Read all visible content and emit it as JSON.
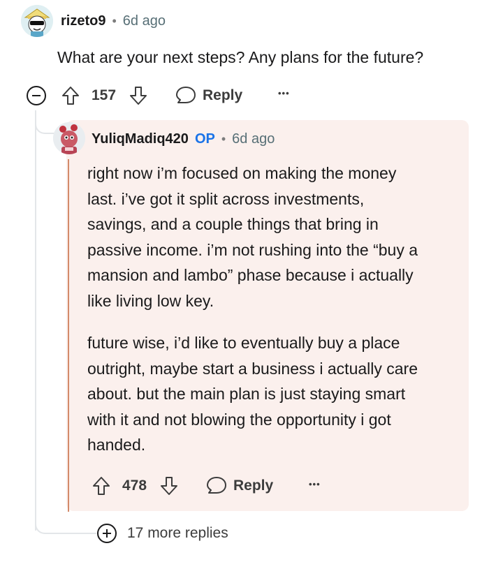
{
  "comment": {
    "username": "rizeto9",
    "separator": "•",
    "time": "6d ago",
    "body": "What are your next steps? Any plans for the future?",
    "votes": "157",
    "reply_label": "Reply",
    "more_label": "•••"
  },
  "reply": {
    "username": "YuliqMadiq420",
    "op_badge": "OP",
    "separator": "•",
    "time": "6d ago",
    "paragraph1": [
      "right now i’m focused on making the money",
      "last. i’ve got it split across investments,",
      "savings, and a couple things that bring in",
      "passive income. i’m not rushing into the “buy a",
      "mansion and lambo” phase because i actually",
      "like living low key."
    ],
    "paragraph2": [
      "future wise, i’d like to eventually buy a place",
      "outright, maybe start a business i actually care",
      "about. but the main plan is just staying smart",
      "with it and not blowing the opportunity i got",
      "handed."
    ],
    "votes": "478",
    "reply_label": "Reply",
    "more_label": "•••"
  },
  "more_replies": {
    "label": "17 more replies"
  },
  "colors": {
    "highlight_bg": "#fbf0ed",
    "op_blue": "#1a73e8",
    "accent_line": "#d38a6a"
  }
}
